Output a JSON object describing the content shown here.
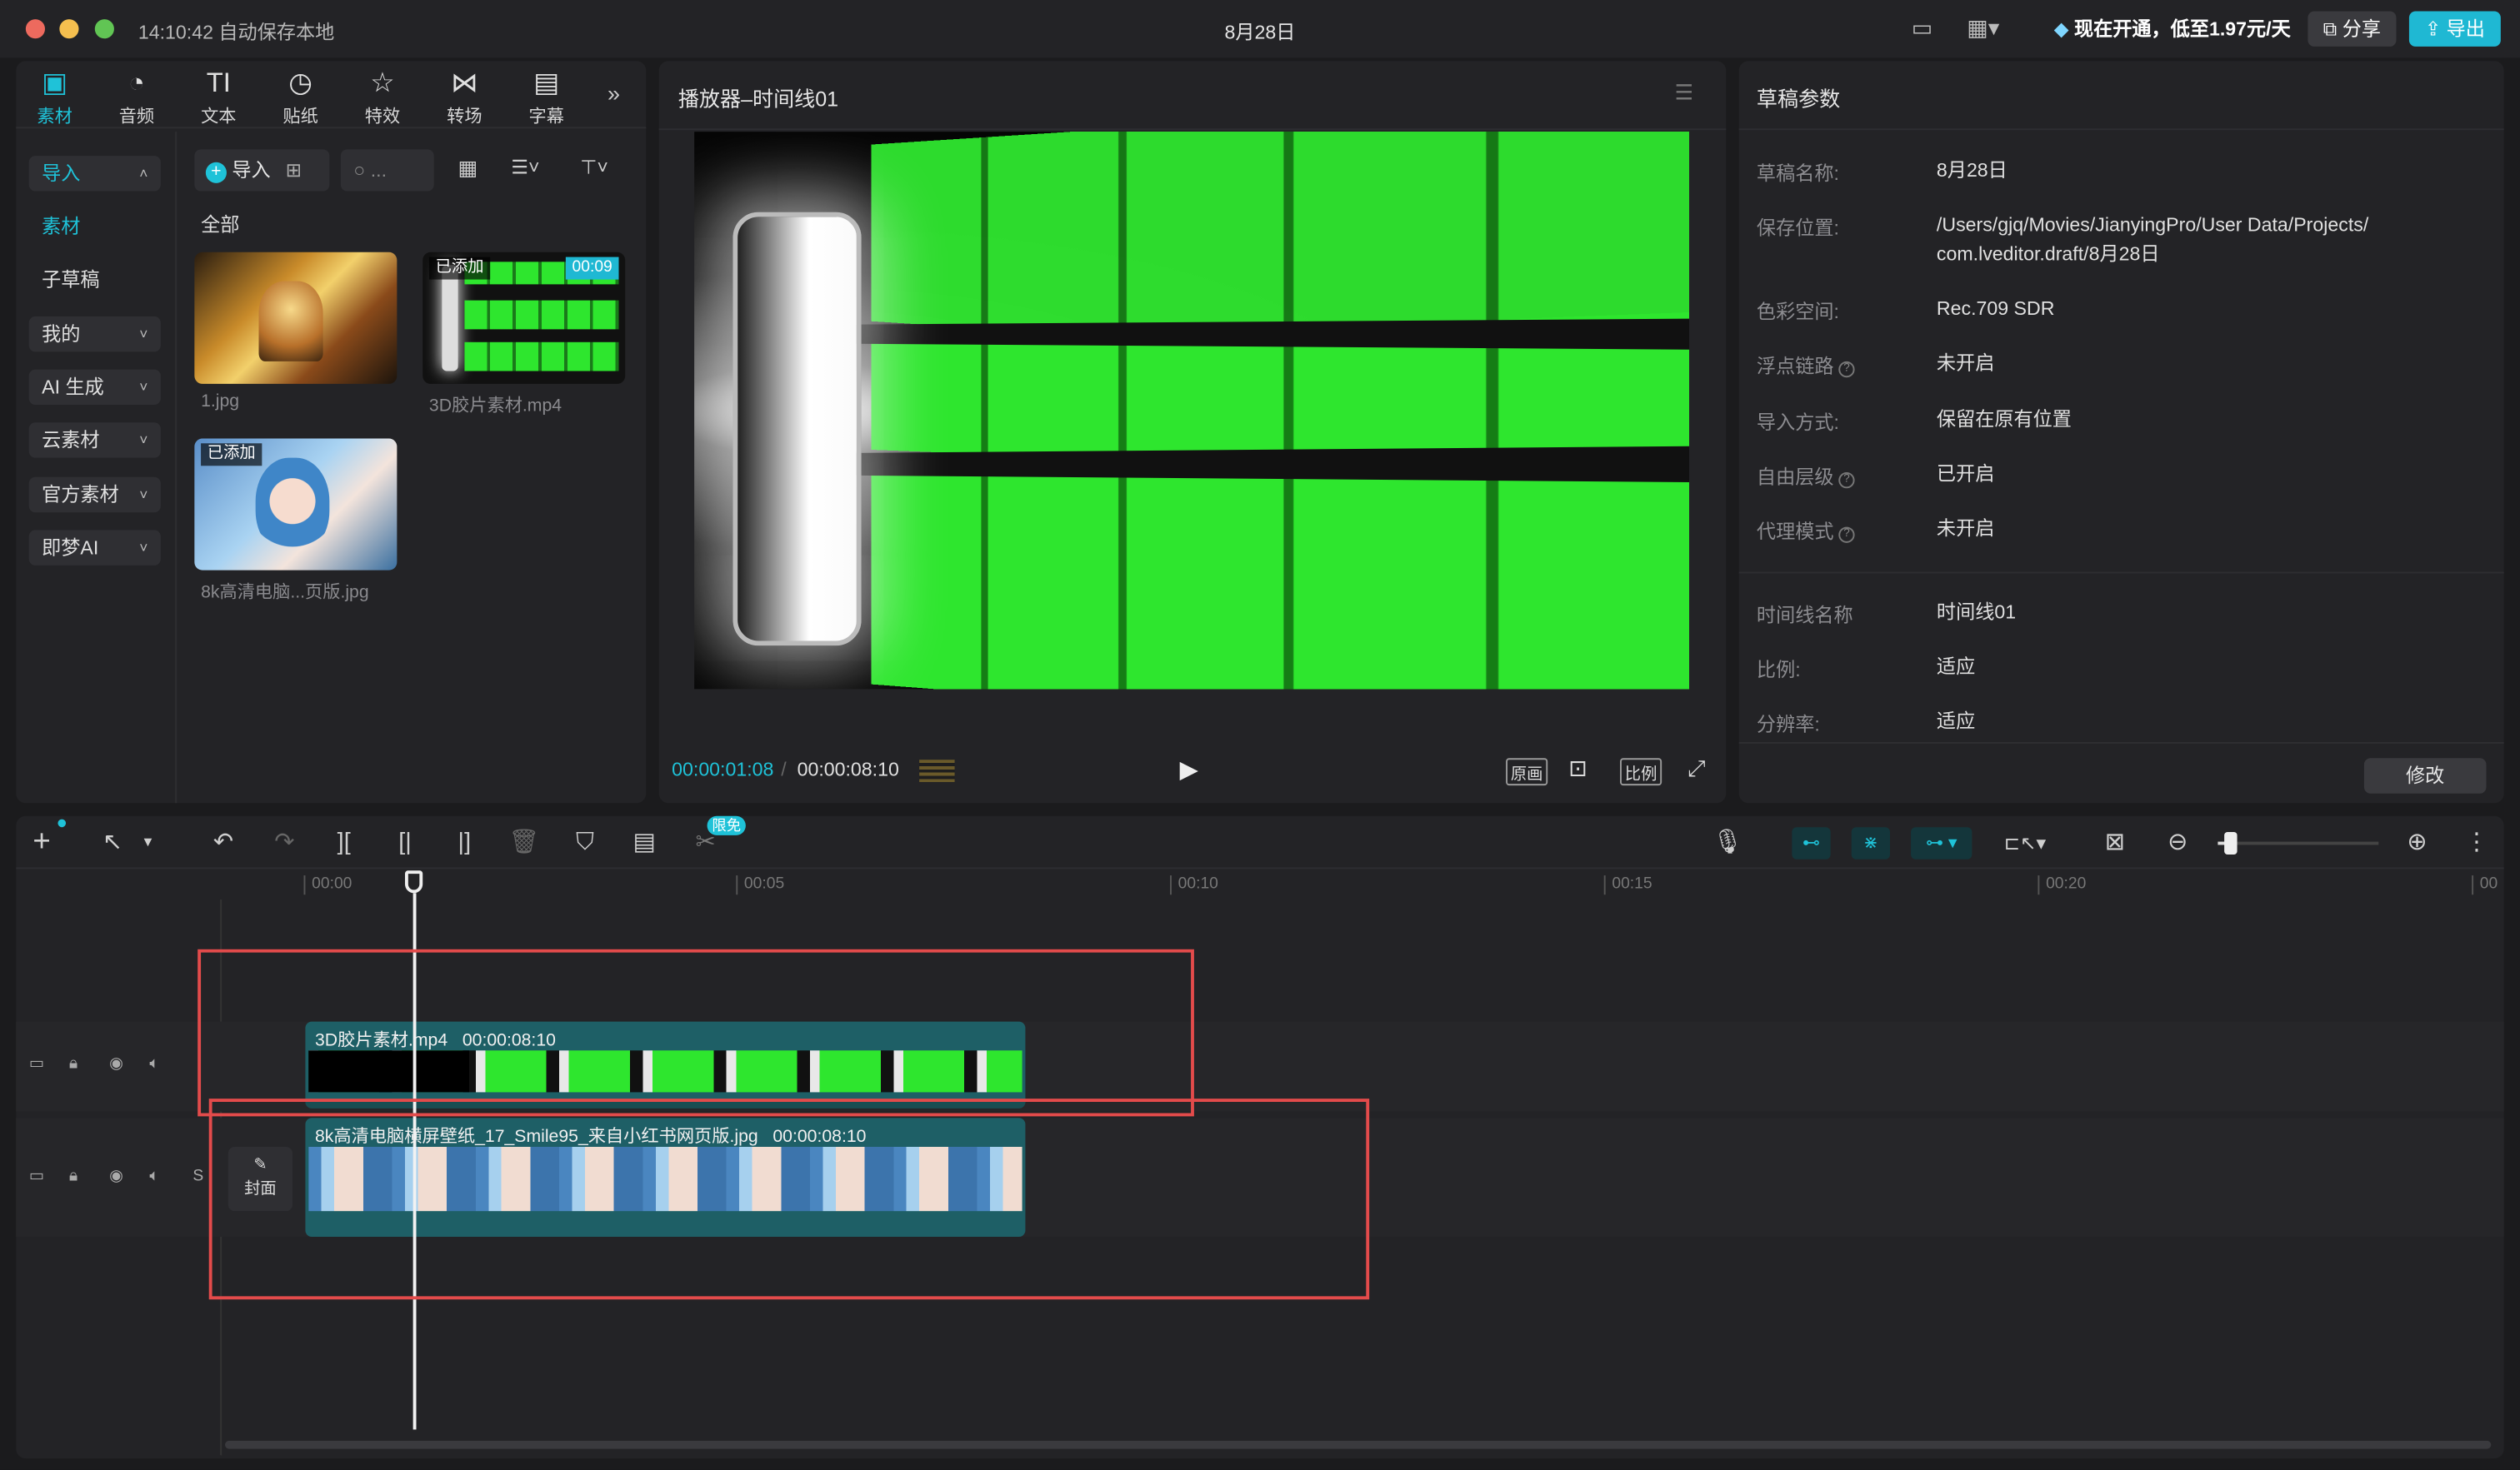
{
  "titlebar": {
    "time": "14:10:42",
    "autosave": "自动保存本地",
    "title": "8月28日",
    "promo": "现在开通，低至1.97元/天",
    "share": "分享",
    "export": "导出"
  },
  "media_tabs": [
    {
      "label": "素材",
      "icon": "media-icon"
    },
    {
      "label": "音频",
      "icon": "audio-icon"
    },
    {
      "label": "文本",
      "icon": "text-icon"
    },
    {
      "label": "贴纸",
      "icon": "sticker-icon"
    },
    {
      "label": "特效",
      "icon": "effects-icon"
    },
    {
      "label": "转场",
      "icon": "transition-icon"
    },
    {
      "label": "字幕",
      "icon": "caption-icon"
    }
  ],
  "sidebar": [
    {
      "label": "导入"
    },
    {
      "label": "素材"
    },
    {
      "label": "子草稿"
    },
    {
      "label": "我的"
    },
    {
      "label": "AI 生成"
    },
    {
      "label": "云素材"
    },
    {
      "label": "官方素材"
    },
    {
      "label": "即梦AI"
    }
  ],
  "media": {
    "import_label": "导入",
    "search_placeholder": "...",
    "section": "全部",
    "items": [
      {
        "name": "1.jpg",
        "badge": "",
        "duration": ""
      },
      {
        "name": "3D胶片素材.mp4",
        "badge": "已添加",
        "duration": "00:09"
      },
      {
        "name": "8k高清电脑...页版.jpg",
        "badge": "已添加",
        "duration": ""
      }
    ]
  },
  "player": {
    "title": "播放器–时间线01",
    "current": "00:00:01:08",
    "total": "00:00:08:10",
    "btn_original": "原画",
    "btn_ratio": "比例"
  },
  "props": {
    "title": "草稿参数",
    "rows": [
      {
        "label": "草稿名称:",
        "value": "8月28日"
      },
      {
        "label": "保存位置:",
        "value": "/Users/gjq/Movies/JianyingPro/User Data/Projects/",
        "value2": "com.lveditor.draft/8月28日"
      },
      {
        "label": "色彩空间:",
        "value": "Rec.709 SDR"
      },
      {
        "label": "浮点链路",
        "value": "未开启"
      },
      {
        "label": "导入方式:",
        "value": "保留在原有位置"
      },
      {
        "label": "自由层级",
        "value": "已开启"
      },
      {
        "label": "代理模式",
        "value": "未开启"
      },
      {
        "label": "时间线名称",
        "value": "时间线01"
      },
      {
        "label": "比例:",
        "value": "适应"
      },
      {
        "label": "分辨率:",
        "value": "适应"
      }
    ],
    "modify": "修改"
  },
  "timeline": {
    "free_badge": "限免",
    "ruler": [
      "00:00",
      "00:05",
      "00:10",
      "00:15",
      "00:20",
      "00"
    ],
    "cover_label": "封面",
    "clips": [
      {
        "name": "3D胶片素材.mp4",
        "duration": "00:00:08:10"
      },
      {
        "name": "8k高清电脑横屏壁纸_17_Smile95_来自小红书网页版.jpg",
        "duration": "00:00:08:10"
      }
    ]
  },
  "colors": {
    "accent": "#1fc2d8",
    "annotation": "#e34b4b",
    "clip": "#1e5f66",
    "green_screen": "#2ee62e"
  }
}
